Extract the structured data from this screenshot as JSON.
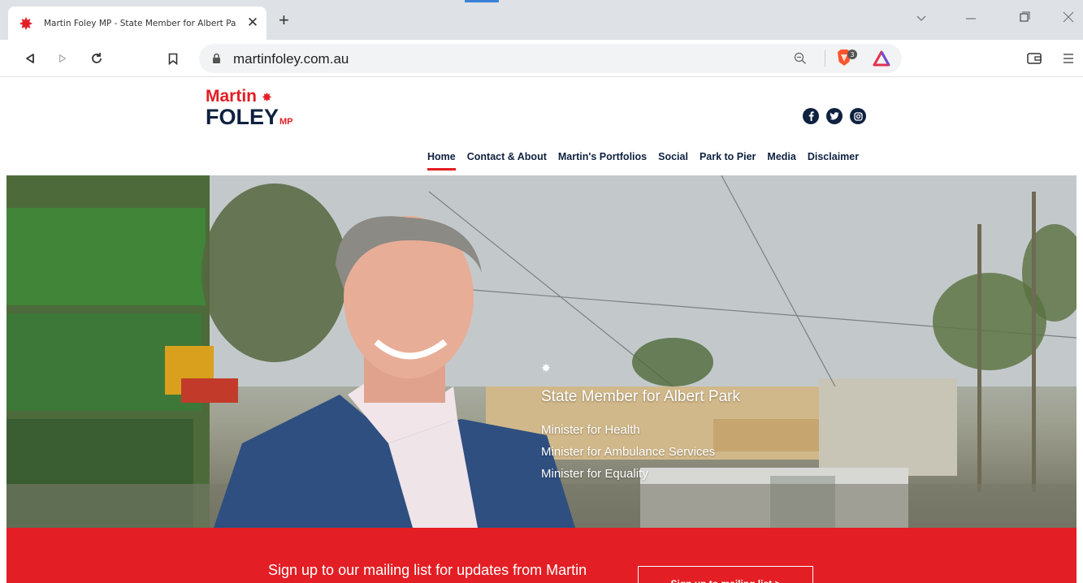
{
  "browser": {
    "tab_title": "Martin Foley MP - State Member for Albert Park.",
    "url": "martinfoley.com.au",
    "brave_badge": "3",
    "icons": [
      "back-icon",
      "forward-icon",
      "reload-icon",
      "bookmark-icon",
      "lock-icon",
      "zoom-icon",
      "brave-shield-icon",
      "brave-rewards-icon",
      "wallet-icon",
      "menu-icon"
    ]
  },
  "site": {
    "logo": {
      "line1": "Martin",
      "line2": "FOLEY",
      "suffix": "MP"
    },
    "social_icons": [
      "facebook-icon",
      "twitter-icon",
      "instagram-icon"
    ],
    "nav": [
      {
        "label": "Home",
        "active": true
      },
      {
        "label": "Contact & About",
        "active": false
      },
      {
        "label": "Martin's Portfolios",
        "active": false
      },
      {
        "label": "Social",
        "active": false
      },
      {
        "label": "Park to Pier",
        "active": false
      },
      {
        "label": "Media",
        "active": false
      },
      {
        "label": "Disclaimer",
        "active": false
      }
    ],
    "hero": {
      "title": "State Member for Albert Park",
      "roles": [
        "Minister for Health",
        "Minister for Ambulance Services",
        "Minister for Equality"
      ]
    },
    "banner": {
      "text": "Sign up to our mailing list for updates from Martin",
      "button": "Sign up to mailing list >"
    },
    "colors": {
      "brand_red": "#e31e24",
      "navy": "#0f2140"
    }
  }
}
